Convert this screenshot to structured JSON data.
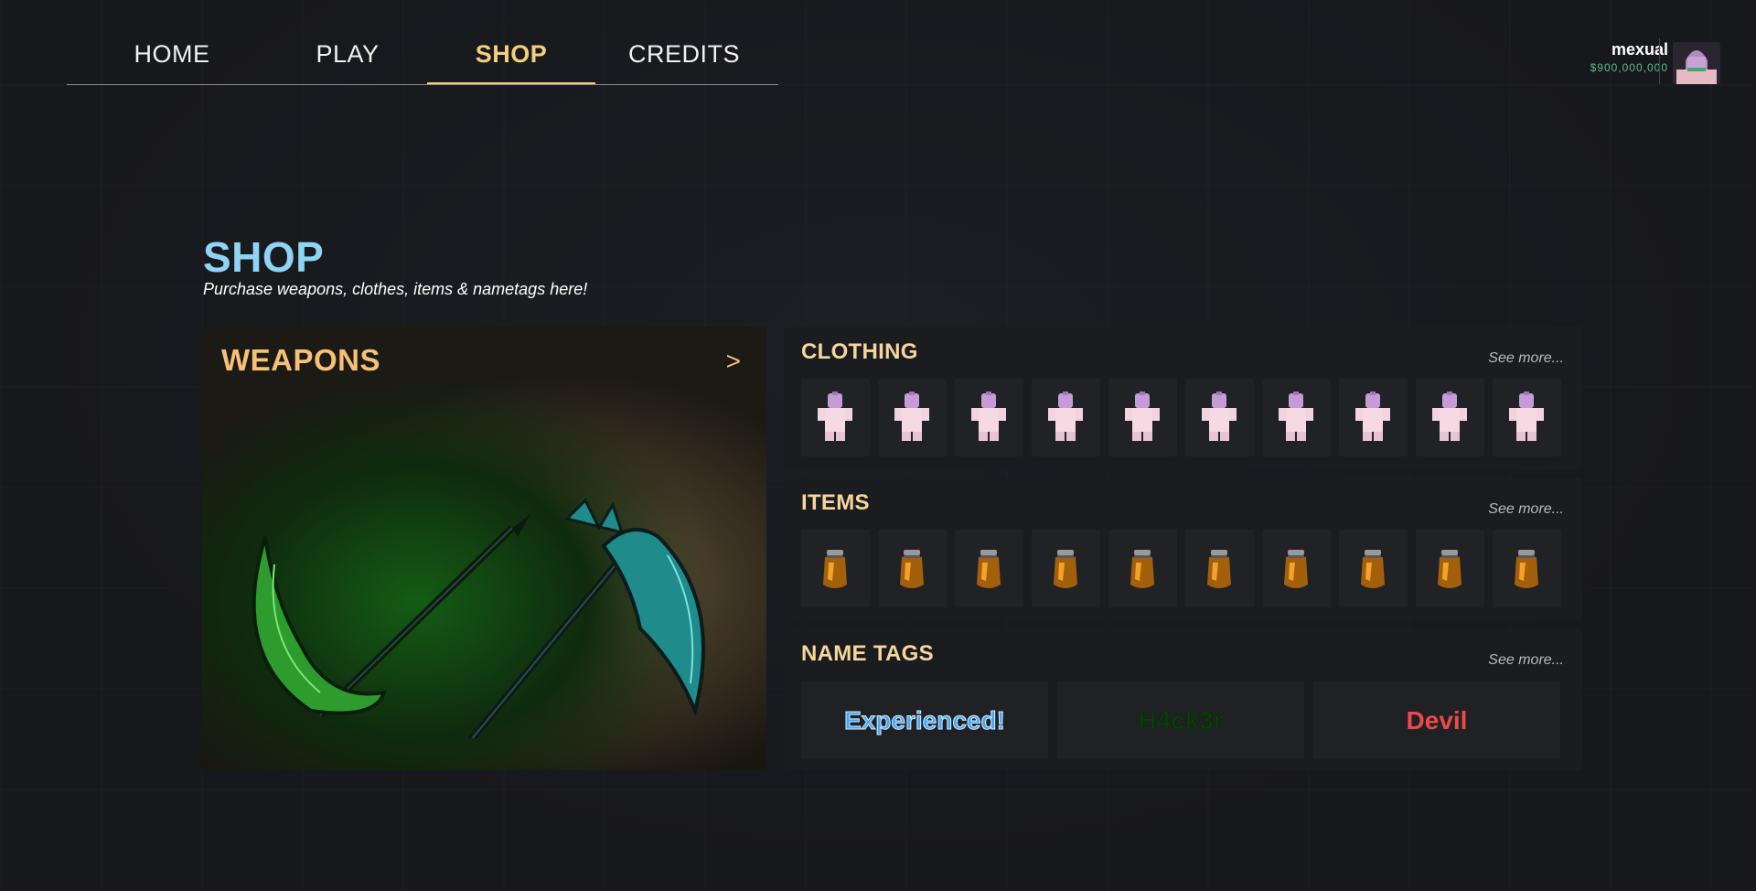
{
  "nav": {
    "items": [
      {
        "label": "HOME"
      },
      {
        "label": "PLAY"
      },
      {
        "label": "SHOP"
      },
      {
        "label": "CREDITS"
      }
    ],
    "active": "SHOP"
  },
  "user": {
    "name": "mexual",
    "balance": "$900,000,000",
    "avatar_icon": "avatar-thumbnail"
  },
  "header": {
    "title": "SHOP",
    "subtitle": "Purchase weapons, clothes, items & nametags here!"
  },
  "weapons": {
    "title": "WEAPONS",
    "arrow": ">",
    "image": "dual-scythes-image"
  },
  "clothing": {
    "title": "CLOTHING",
    "see_more": "See more...",
    "item_icon": "clothing-outfit-icon",
    "count": 10
  },
  "items": {
    "title": "ITEMS",
    "see_more": "See more...",
    "item_icon": "potion-icon",
    "count": 10
  },
  "nametags": {
    "title": "NAME TAGS",
    "see_more": "See more...",
    "tags": [
      {
        "label": "Experienced!",
        "color": "#45a8f5"
      },
      {
        "label": "H4ck3r",
        "color": "#0e3a0e"
      },
      {
        "label": "Devil",
        "color": "#ec4a4a"
      }
    ]
  },
  "colors": {
    "accent": "#f3cf7d",
    "title": "#8fd3f5",
    "balance": "#5dbb8c"
  }
}
